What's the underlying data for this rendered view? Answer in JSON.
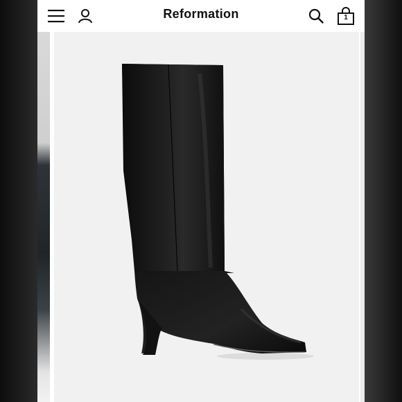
{
  "header": {
    "brand": "Reformation",
    "menu_icon": "hamburger-menu-icon",
    "account_icon": "user-account-icon",
    "search_icon": "search-icon",
    "bag_icon": "shopping-bag-icon",
    "bag_count": "1"
  },
  "gallery": {
    "main_image": "black-leather-knee-high-boot",
    "background_color": "#f2f1f1",
    "product_color": "#111111"
  }
}
